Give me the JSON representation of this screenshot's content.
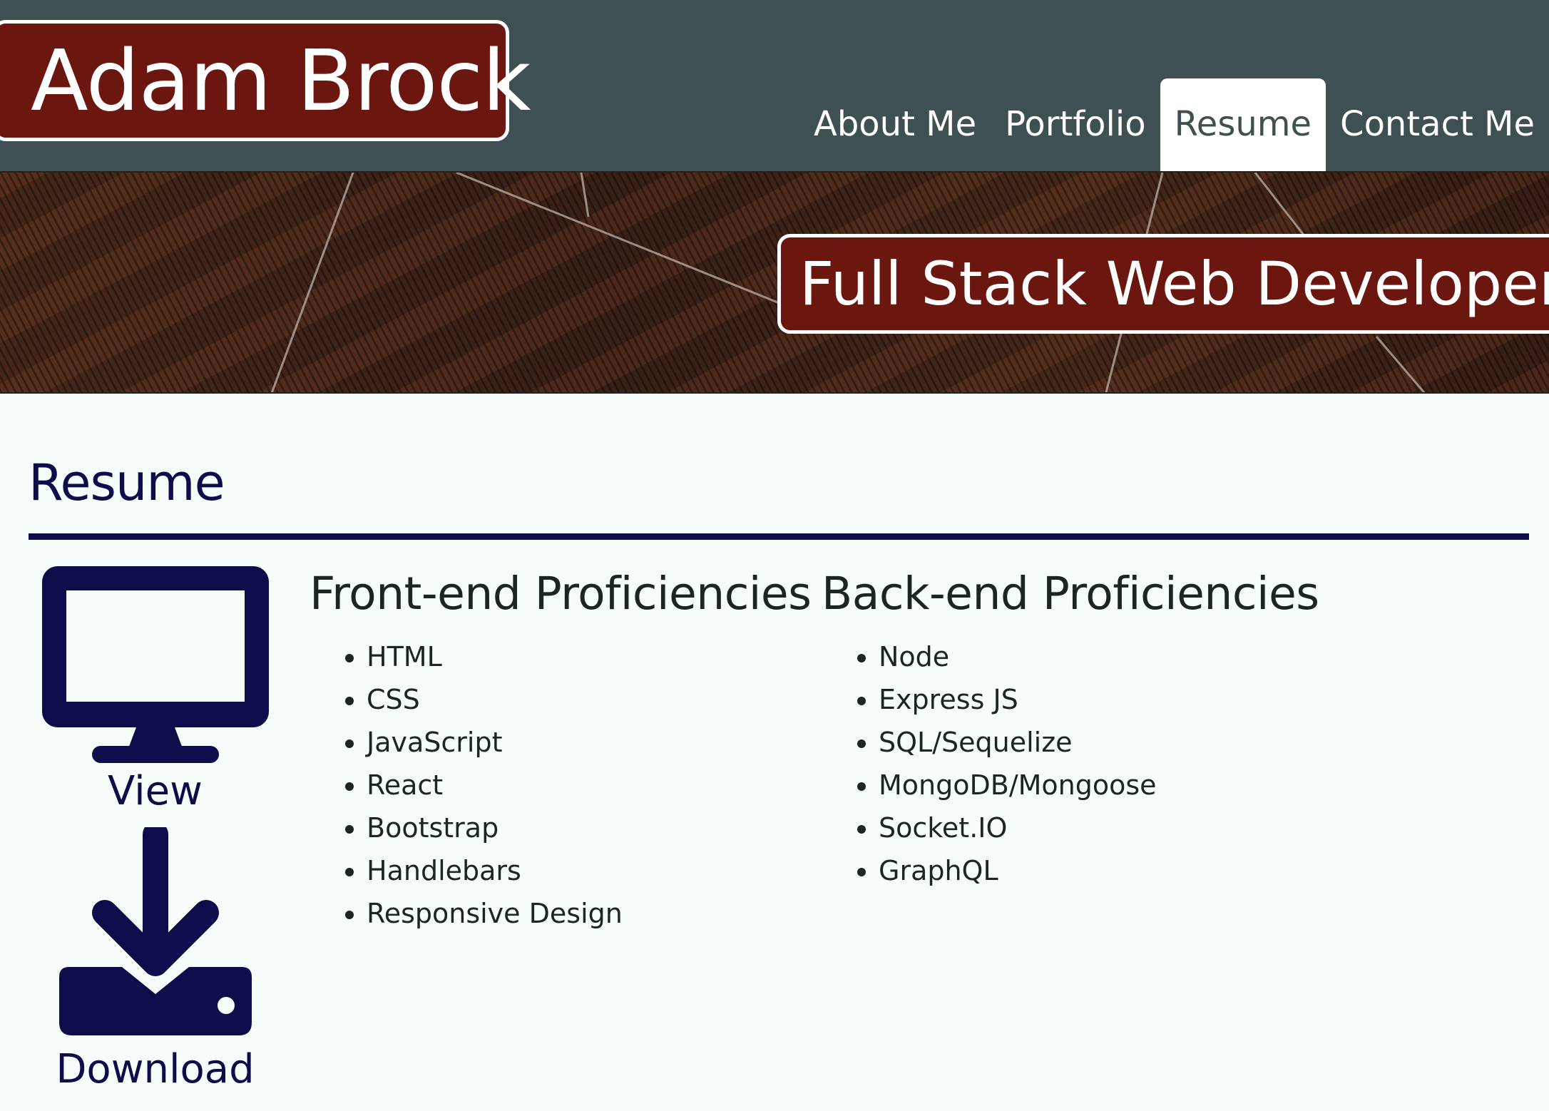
{
  "header": {
    "brand": "Adam Brock",
    "nav": [
      {
        "label": "About Me",
        "active": false
      },
      {
        "label": "Portfolio",
        "active": false
      },
      {
        "label": "Resume",
        "active": true
      },
      {
        "label": "Contact Me",
        "active": false
      }
    ]
  },
  "banner": {
    "tagline": "Full Stack Web Developer"
  },
  "main": {
    "title": "Resume",
    "actions": {
      "view": {
        "label": "View",
        "icon": "monitor-icon"
      },
      "download": {
        "label": "Download",
        "icon": "download-icon"
      }
    },
    "frontend": {
      "heading": "Front-end Proficiencies",
      "items": [
        "HTML",
        "CSS",
        "JavaScript",
        "React",
        "Bootstrap",
        "Handlebars",
        "Responsive Design"
      ]
    },
    "backend": {
      "heading": "Back-end Proficiencies",
      "items": [
        "Node",
        "Express JS",
        "SQL/Sequelize",
        "MongoDB/Mongoose",
        "Socket.IO",
        "GraphQL"
      ]
    }
  },
  "colors": {
    "header_bg": "#3e5051",
    "accent_red": "#6c1610",
    "navy": "#0e0c4a",
    "page_bg": "#f6fcf9"
  }
}
